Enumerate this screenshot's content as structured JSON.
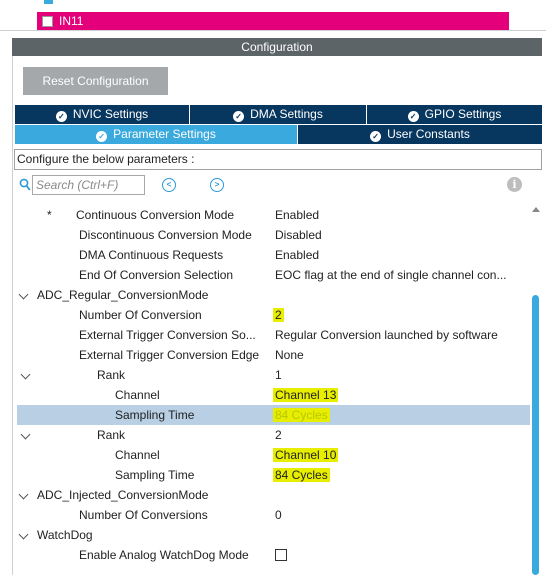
{
  "top_item": {
    "label": "IN11"
  },
  "config_title": "Configuration",
  "reset_button": "Reset Configuration",
  "tabs": [
    {
      "label": "NVIC Settings"
    },
    {
      "label": "DMA Settings"
    },
    {
      "label": "GPIO Settings"
    },
    {
      "label": "Parameter Settings"
    },
    {
      "label": "User Constants"
    }
  ],
  "hint": "Configure the below parameters :",
  "search": {
    "placeholder": "Search (Ctrl+F)"
  },
  "icons": {
    "search": "search-icon",
    "prev": "chevron-left-icon",
    "next": "chevron-right-icon",
    "info": "info-icon",
    "check": "check-circle-icon",
    "expand": "chevron-down-icon"
  },
  "colors": {
    "tab_dark": "#07365e",
    "tab_light": "#3aa9dd",
    "header": "#5d6468",
    "highlight": "#e8ee00",
    "selected_row": "#b8cfe4",
    "pink": "#e3007a"
  },
  "params": {
    "r1": {
      "star": "*",
      "name": "Continuous Conversion Mode",
      "value": "Enabled"
    },
    "r2": {
      "name": "Discontinuous Conversion Mode",
      "value": "Disabled"
    },
    "r3": {
      "name": "DMA Continuous Requests",
      "value": "Enabled"
    },
    "r4": {
      "name": "End Of Conversion Selection",
      "value": "EOC flag at the end of single channel con..."
    },
    "g1": {
      "name": "ADC_Regular_ConversionMode"
    },
    "r5": {
      "name": "Number Of Conversion",
      "value": "2"
    },
    "r6": {
      "name": "External Trigger Conversion So...",
      "value": "Regular Conversion launched by software"
    },
    "r7": {
      "name": "External Trigger Conversion Edge",
      "value": "None"
    },
    "rank1": {
      "name": "Rank",
      "value": "1"
    },
    "r8": {
      "name": "Channel",
      "value": "Channel 13"
    },
    "r9": {
      "name": "Sampling Time",
      "value": "84 Cycles"
    },
    "rank2": {
      "name": "Rank",
      "value": "2"
    },
    "r10": {
      "name": "Channel",
      "value": "Channel 10"
    },
    "r11": {
      "name": "Sampling Time",
      "value": "84 Cycles"
    },
    "g2": {
      "name": "ADC_Injected_ConversionMode"
    },
    "r12": {
      "name": "Number Of Conversions",
      "value": "0"
    },
    "g3": {
      "name": "WatchDog"
    },
    "r13": {
      "name": "Enable Analog WatchDog Mode"
    }
  }
}
